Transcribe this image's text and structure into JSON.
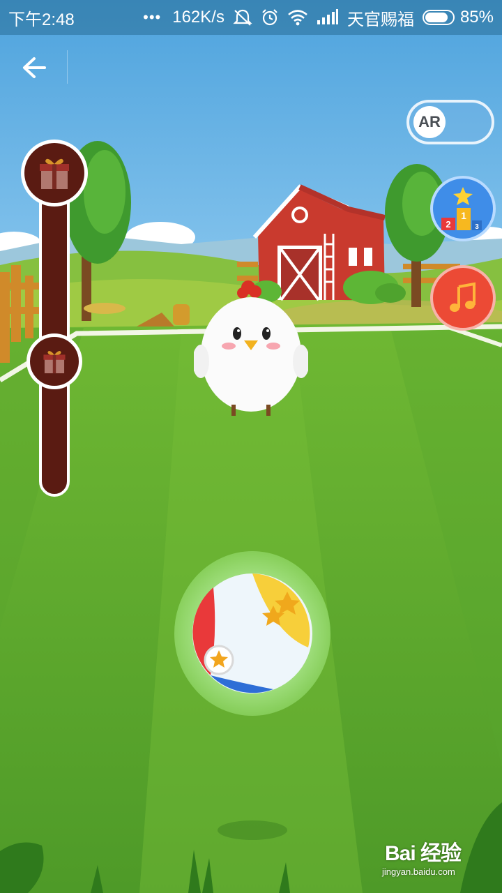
{
  "status_bar": {
    "time": "下午2:48",
    "more": "•••",
    "network_speed": "162K/s",
    "carrier": "天官赐福",
    "battery_percent": "85%",
    "battery_level": 0.85
  },
  "ar_toggle": {
    "label": "AR",
    "enabled": false
  },
  "progress": {
    "level": 0.0
  },
  "watermark": {
    "logo": "Bai 经验",
    "url": "jingyan.baidu.com"
  },
  "colors": {
    "leaderboard": "#3f8de8",
    "music": "#ec4a35",
    "track": "#5a1b12"
  },
  "icons": [
    "back-arrow-icon",
    "mute-icon",
    "alarm-icon",
    "wifi-icon",
    "signal-icon",
    "battery-icon",
    "gift-icon",
    "podium-icon",
    "music-note-icon",
    "beach-ball-icon"
  ]
}
